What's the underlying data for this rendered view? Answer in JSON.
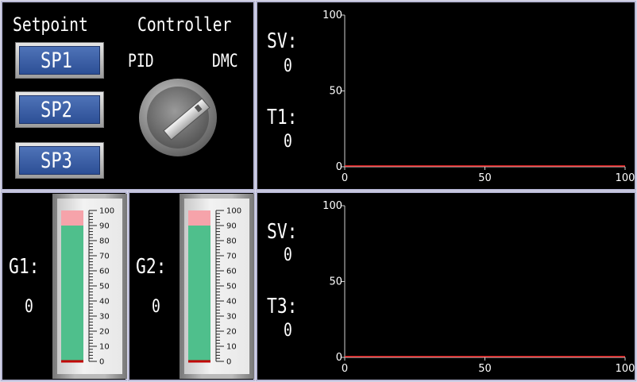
{
  "controls": {
    "setpoint_title": "Setpoint",
    "controller_title": "Controller",
    "mode_left": "PID",
    "mode_right": "DMC",
    "buttons": [
      {
        "label": "SP1"
      },
      {
        "label": "SP2"
      },
      {
        "label": "SP3"
      }
    ]
  },
  "gauges": [
    {
      "label": "G1:",
      "value": "0",
      "level": 0,
      "red_band_min": 90,
      "ticks": [
        "100",
        "90",
        "80",
        "70",
        "60",
        "50",
        "40",
        "30",
        "20",
        "10",
        "0"
      ]
    },
    {
      "label": "G2:",
      "value": "0",
      "level": 0,
      "red_band_min": 90,
      "ticks": [
        "100",
        "90",
        "80",
        "70",
        "60",
        "50",
        "40",
        "30",
        "20",
        "10",
        "0"
      ]
    }
  ],
  "charts": [
    {
      "sv_label": "SV:",
      "sv_value": "0",
      "pv_label": "T1:",
      "pv_value": "0"
    },
    {
      "sv_label": "SV:",
      "sv_value": "0",
      "pv_label": "T3:",
      "pv_value": "0"
    }
  ],
  "chart_data": [
    {
      "type": "line",
      "x_ticks": [
        "0",
        "50",
        "100"
      ],
      "y_ticks": [
        "100",
        "50",
        "0"
      ],
      "xlim": [
        0,
        100
      ],
      "ylim": [
        0,
        100
      ],
      "series": [
        {
          "color": "#ff2a2a",
          "x": [
            0,
            100
          ],
          "y": [
            0,
            0
          ]
        }
      ]
    },
    {
      "type": "line",
      "x_ticks": [
        "0",
        "50",
        "100"
      ],
      "y_ticks": [
        "100",
        "50",
        "0"
      ],
      "xlim": [
        0,
        100
      ],
      "ylim": [
        0,
        100
      ],
      "series": [
        {
          "color": "#ff2a2a",
          "x": [
            0,
            100
          ],
          "y": [
            0,
            0
          ]
        }
      ]
    }
  ],
  "colors": {
    "panel_bg": "#000000",
    "panel_border": "#b9b9d6",
    "button_blue": "#3a5ea8",
    "trend_line": "#ff2a2a",
    "gauge_green": "#57c994",
    "gauge_pink": "#f6a3aa",
    "gauge_red": "#c00000"
  }
}
